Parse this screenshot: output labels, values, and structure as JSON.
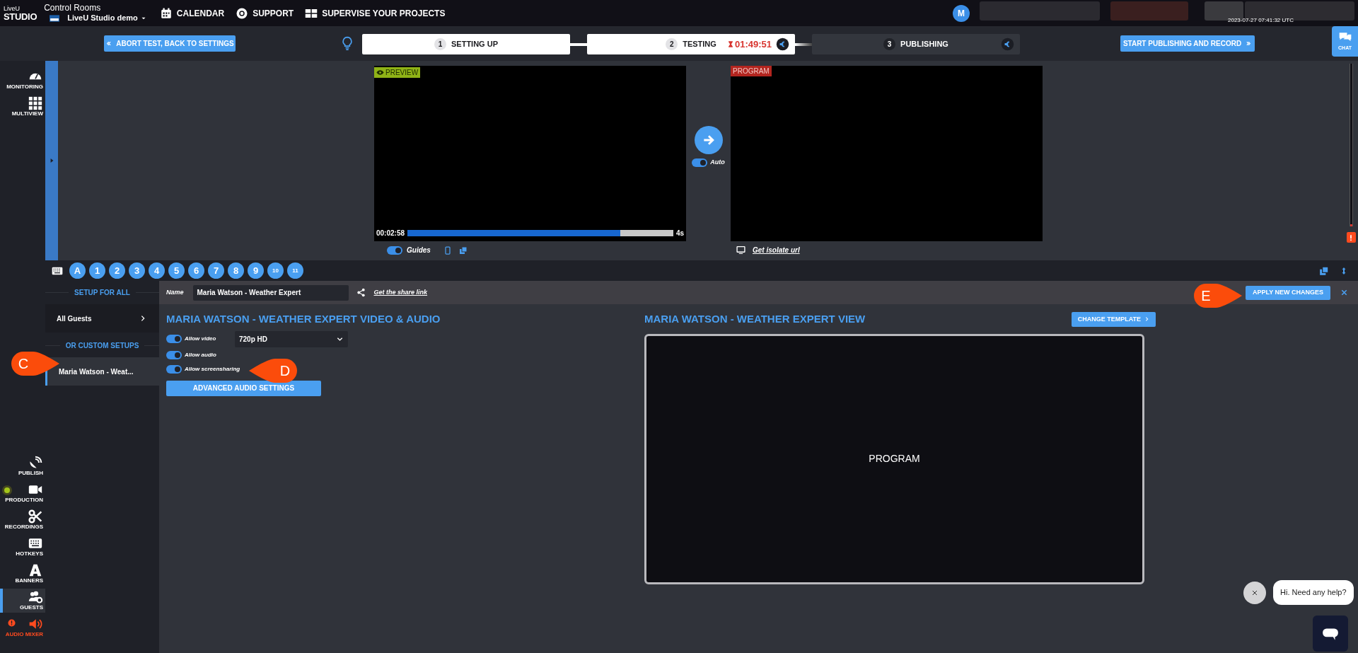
{
  "top_bar": {
    "logo": [
      "LiveU",
      "STUDIO"
    ],
    "section_title": "Control Rooms",
    "workspace": "LiveU Studio demo",
    "menu": [
      {
        "kind": "calendar",
        "label": "CALENDAR"
      },
      {
        "kind": "support",
        "label": "SUPPORT"
      },
      {
        "kind": "projects",
        "label": "SUPERVISE YOUR PROJECTS"
      }
    ],
    "avatar": "M",
    "timestamp": "2023-07-27 07:41:32 UTC"
  },
  "steps_bar": {
    "back_button": "ABORT TEST, BACK TO SETTINGS",
    "steps": [
      {
        "number": "1",
        "label": "SETTING UP",
        "reached": true
      },
      {
        "number": "2",
        "label": "TESTING",
        "reached": true,
        "timer": "01:49:51",
        "credit": true
      },
      {
        "number": "3",
        "label": "PUBLISHING",
        "reached": false,
        "credit": true
      }
    ],
    "next_button": "START PUBLISHING AND RECORD",
    "chat_button": "CHAT"
  },
  "side_nav": [
    {
      "kind": "monitoring",
      "label": "MONITORING",
      "selected": false,
      "alert": false,
      "live": false
    },
    {
      "kind": "multiview",
      "label": "MULTIVIEW",
      "selected": false,
      "alert": false,
      "live": false
    },
    {
      "kind": "publish",
      "label": "PUBLISH",
      "selected": false,
      "alert": false,
      "live": false
    },
    {
      "kind": "production",
      "label": "PRODUCTION",
      "selected": false,
      "alert": false,
      "live": true
    },
    {
      "kind": "recordings",
      "label": "RECORDINGS",
      "selected": false,
      "alert": false,
      "live": false
    },
    {
      "kind": "hotkeys",
      "label": "HOTKEYS",
      "selected": false,
      "alert": false,
      "live": false
    },
    {
      "kind": "banners",
      "label": "BANNERS",
      "selected": false,
      "alert": false,
      "live": false
    },
    {
      "kind": "guests",
      "label": "GUESTS",
      "selected": true,
      "alert": false,
      "live": false
    },
    {
      "kind": "audio",
      "label": "AUDIO MIXER",
      "selected": false,
      "alert": true,
      "live": false
    }
  ],
  "preview": {
    "badge": "PREVIEW",
    "elapsed": "00:02:58",
    "remaining": "4s",
    "level": 0.8,
    "guides": {
      "label": "Guides",
      "on": true
    }
  },
  "transition": {
    "auto": {
      "label": "Auto",
      "on": true
    }
  },
  "program": {
    "badge": "PROGRAM",
    "link": "Get isolate url"
  },
  "slots": [
    "A",
    "1",
    "2",
    "3",
    "4",
    "5",
    "6",
    "7",
    "8",
    "9",
    "10",
    "11"
  ],
  "guests_panel": {
    "sections": [
      {
        "title": "SETUP FOR ALL",
        "items": [
          {
            "label": "All Guests",
            "selected": false
          }
        ]
      },
      {
        "title": "OR CUSTOM SETUPS",
        "items": [
          {
            "label": "Maria Watson - Weat...",
            "selected": true
          }
        ]
      }
    ],
    "name_label": "Name",
    "name_value": "Maria Watson - Weather Expert",
    "share_link": "Get the share link",
    "apply_button": "APPLY NEW CHANGES",
    "media": {
      "heading": "MARIA WATSON - WEATHER EXPERT VIDEO & AUDIO",
      "options": [
        {
          "label": "Allow video",
          "on": true
        },
        {
          "label": "Allow audio",
          "on": true
        },
        {
          "label": "Allow screensharing",
          "on": true
        }
      ],
      "quality": "720p HD",
      "audio_button": "ADVANCED AUDIO SETTINGS"
    },
    "view": {
      "heading": "MARIA WATSON - WEATHER EXPERT VIEW",
      "template_button": "CHANGE TEMPLATE",
      "layout_label": "PROGRAM"
    }
  },
  "help_chat": {
    "greeting": "Hi. Need any help?"
  },
  "callouts": [
    {
      "letter": "C"
    },
    {
      "letter": "D"
    },
    {
      "letter": "E"
    }
  ]
}
